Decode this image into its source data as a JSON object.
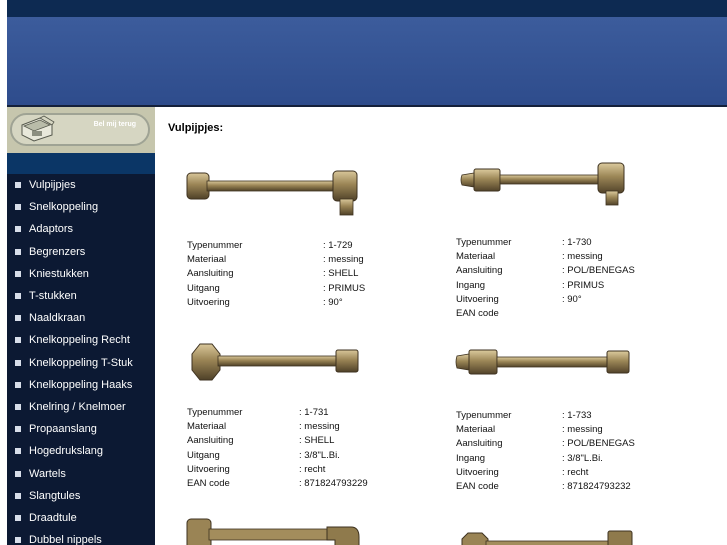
{
  "sidebar": {
    "callback_label": "Bel mij terug",
    "items": [
      {
        "label": "Vulpijpjes"
      },
      {
        "label": "Snelkoppeling"
      },
      {
        "label": "Adaptors"
      },
      {
        "label": "Begrenzers"
      },
      {
        "label": "Kniestukken"
      },
      {
        "label": "T-stukken"
      },
      {
        "label": "Naaldkraan"
      },
      {
        "label": "Knelkoppeling Recht"
      },
      {
        "label": "Knelkoppeling T-Stuk"
      },
      {
        "label": "Knelkoppeling Haaks"
      },
      {
        "label": "Knelring / Knelmoer"
      },
      {
        "label": "Propaanslang"
      },
      {
        "label": "Hogedrukslang"
      },
      {
        "label": "Wartels"
      },
      {
        "label": "Slangtules"
      },
      {
        "label": "Draadtule"
      },
      {
        "label": "Dubbel nippels"
      }
    ]
  },
  "main": {
    "title": "Vulpijpjes:",
    "products": [
      {
        "rows": [
          {
            "k": "Typenummer",
            "v": ": 1-729"
          },
          {
            "k": "Materiaal",
            "v": ": messing"
          },
          {
            "k": "Aansluiting",
            "v": ": SHELL"
          },
          {
            "k": "Uitgang",
            "v": ": PRIMUS"
          },
          {
            "k": "Uitvoering",
            "v": ": 90°"
          }
        ]
      },
      {
        "rows": [
          {
            "k": "Typenummer",
            "v": ": 1-730"
          },
          {
            "k": "Materiaal",
            "v": ": messing"
          },
          {
            "k": "Aansluiting",
            "v": ": POL/BENEGAS"
          },
          {
            "k": "Ingang",
            "v": ": PRIMUS"
          },
          {
            "k": "Uitvoering",
            "v": ": 90°"
          },
          {
            "k": "EAN code",
            "v": ""
          }
        ]
      },
      {
        "rows": [
          {
            "k": "Typenummer",
            "v": ": 1-731"
          },
          {
            "k": "Materiaal",
            "v": ": messing"
          },
          {
            "k": "Aansluiting",
            "v": ": SHELL"
          },
          {
            "k": "Uitgang",
            "v": ": 3/8\"L.Bi."
          },
          {
            "k": "Uitvoering",
            "v": ": recht"
          },
          {
            "k": "EAN code",
            "v": ": 871824793229"
          }
        ]
      },
      {
        "rows": [
          {
            "k": "Typenummer",
            "v": ": 1-733"
          },
          {
            "k": "Materiaal",
            "v": ": messing"
          },
          {
            "k": "Aansluiting",
            "v": ": POL/BENEGAS"
          },
          {
            "k": "Ingang",
            "v": ": 3/8\"L.Bi."
          },
          {
            "k": "Uitvoering",
            "v": ": recht"
          },
          {
            "k": "EAN code",
            "v": ": 871824793232"
          }
        ]
      }
    ]
  }
}
